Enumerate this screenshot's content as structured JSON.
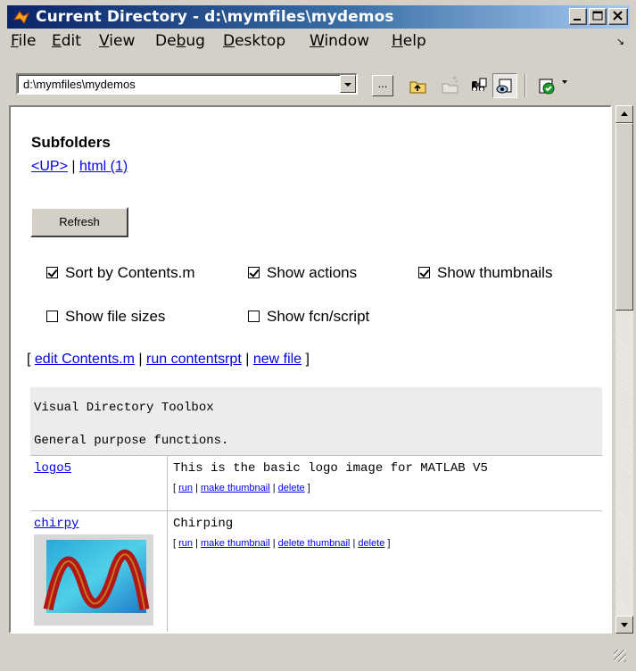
{
  "window": {
    "title": "Current Directory - d:\\mymfiles\\mydemos",
    "controls": [
      "minimize-icon",
      "maximize-icon",
      "close-icon"
    ]
  },
  "menu": {
    "items": [
      {
        "label": "File",
        "mnemonic": "F",
        "rest": "ile"
      },
      {
        "label": "Edit",
        "mnemonic": "E",
        "rest": "dit"
      },
      {
        "label": "View",
        "mnemonic": "V",
        "rest": "iew"
      },
      {
        "label": "Debug",
        "pre": "De",
        "mnemonic": "b",
        "rest": "ug"
      },
      {
        "label": "Desktop",
        "mnemonic": "D",
        "rest": "esktop"
      },
      {
        "label": "Window",
        "mnemonic": "W",
        "rest": "indow"
      },
      {
        "label": "Help",
        "mnemonic": "H",
        "rest": "elp"
      }
    ]
  },
  "toolbar": {
    "path_value": "d:\\mymfiles\\mydemos",
    "browse_label": "...",
    "icons": [
      "browse-icon",
      "up-folder-icon",
      "new-folder-icon",
      "find-icon",
      "visual-directory-icon",
      "check-run-icon"
    ]
  },
  "page": {
    "subfolders_heading": "Subfolders",
    "up_link": "<UP>",
    "separator": "|",
    "html_link": "html (1)",
    "refresh_label": "Refresh",
    "options": {
      "sort_by_contents": {
        "label": "Sort by Contents.m",
        "checked": true
      },
      "show_actions": {
        "label": "Show actions",
        "checked": true
      },
      "show_thumbnails": {
        "label": "Show thumbnails",
        "checked": true
      },
      "show_file_sizes": {
        "label": "Show file sizes",
        "checked": false
      },
      "show_fcn_script": {
        "label": "Show fcn/script",
        "checked": false
      }
    },
    "links": {
      "open_bracket": "[",
      "close_bracket": "]",
      "edit_contents": "edit Contents.m",
      "run_contentsrpt": "run contentsrpt",
      "new_file": "new file"
    },
    "table": {
      "title": "Visual Directory Toolbox",
      "description": "General purpose functions.",
      "rows": [
        {
          "name": "logo5",
          "description": "This is the basic logo image for MATLAB V5",
          "actions": [
            "run",
            "make thumbnail",
            "delete"
          ]
        },
        {
          "name": "chirpy",
          "description": "Chirping",
          "actions": [
            "run",
            "make thumbnail",
            "delete thumbnail",
            "delete"
          ]
        }
      ]
    }
  }
}
